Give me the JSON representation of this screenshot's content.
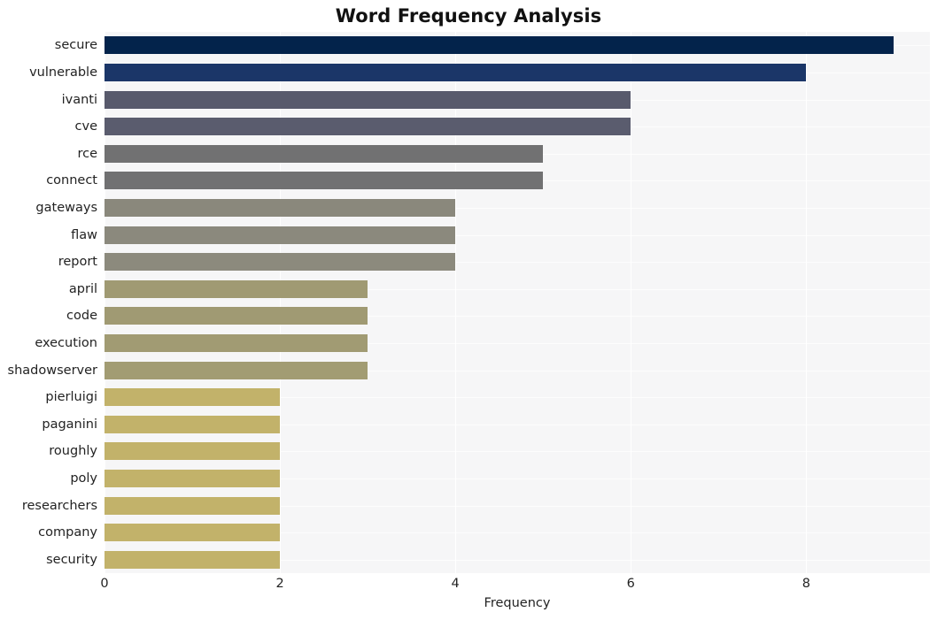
{
  "chart_data": {
    "type": "bar",
    "orientation": "horizontal",
    "title": "Word Frequency Analysis",
    "xlabel": "Frequency",
    "ylabel": "",
    "categories": [
      "secure",
      "vulnerable",
      "ivanti",
      "cve",
      "rce",
      "connect",
      "gateways",
      "flaw",
      "report",
      "april",
      "code",
      "execution",
      "shadowserver",
      "pierluigi",
      "paganini",
      "roughly",
      "poly",
      "researchers",
      "company",
      "security"
    ],
    "values": [
      9,
      8,
      6,
      6,
      5,
      5,
      4,
      4,
      4,
      3,
      3,
      3,
      3,
      2,
      2,
      2,
      2,
      2,
      2,
      2
    ],
    "bar_colors": [
      "#03234b",
      "#1b3668",
      "#585a6c",
      "#5a5c6e",
      "#717172",
      "#717172",
      "#8a887c",
      "#8b897d",
      "#8c8a7d",
      "#a09a73",
      "#a09a73",
      "#a19b73",
      "#a29c73",
      "#c2b26a",
      "#c2b26a",
      "#c2b26a",
      "#c2b26a",
      "#c2b26a",
      "#c2b26a",
      "#c2b26a"
    ],
    "xticks": [
      0,
      2,
      4,
      6,
      8
    ],
    "xlim": [
      0,
      9.41
    ],
    "grid": true,
    "legend": false,
    "plot_background": "#f6f6f7",
    "figure_background": "#ffffff"
  }
}
